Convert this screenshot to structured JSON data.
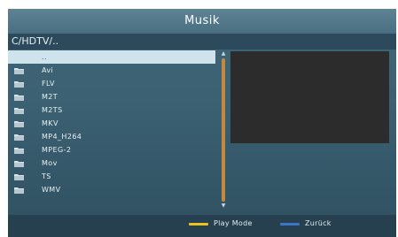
{
  "header": {
    "title": "Musik"
  },
  "path": {
    "current": "C/HDTV/.."
  },
  "file_list": {
    "items": [
      {
        "label": "..",
        "icon": "none",
        "selected": true
      },
      {
        "label": "Avi",
        "icon": "folder-icon"
      },
      {
        "label": "FLV",
        "icon": "folder-icon"
      },
      {
        "label": "M2T",
        "icon": "folder-icon"
      },
      {
        "label": "M2TS",
        "icon": "folder-icon"
      },
      {
        "label": "MKV",
        "icon": "folder-icon"
      },
      {
        "label": "MP4_H264",
        "icon": "folder-icon"
      },
      {
        "label": "MPEG-2",
        "icon": "folder-icon"
      },
      {
        "label": "Mov",
        "icon": "folder-icon"
      },
      {
        "label": "TS",
        "icon": "folder-icon"
      },
      {
        "label": "WMV",
        "icon": "folder-icon"
      }
    ]
  },
  "footer": {
    "play_mode": {
      "label": "Play Mode",
      "color": "#e8c322"
    },
    "back": {
      "label": "Zurück",
      "color": "#3d74c8"
    }
  },
  "colors": {
    "background": "#3b6172",
    "selection": "#cfe3ec",
    "scrollbar": "#c4893f",
    "preview": "#2c2c2c"
  }
}
